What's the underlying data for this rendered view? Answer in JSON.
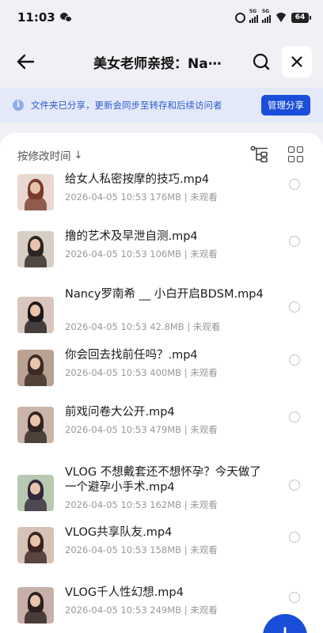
{
  "status_bar": {
    "time": "11:03",
    "signal_1": "5G",
    "signal_2": "5G",
    "battery": "64"
  },
  "header": {
    "title": "美女老师亲授：Na⋯",
    "back_icon": "back-arrow-icon",
    "search_icon": "search-icon",
    "close_icon": "close-icon"
  },
  "share_banner": {
    "info_icon": "i",
    "text": "文件夹已分享，更新会同步至转存和后续访问者",
    "button": "管理分享"
  },
  "toolbar": {
    "sort_label": "按修改时间",
    "sort_arrow": "↓"
  },
  "files": [
    {
      "name": "给女人私密按摩的技巧.mp4",
      "meta": "2026-04-05 10:53  176MB | 未观看",
      "thumb_bg": "#e8d8cf",
      "figure": "#7a3b2e"
    },
    {
      "name": "撸的艺术及早泄自测.mp4",
      "meta": "2026-04-05 10:53  106MB | 未观看",
      "thumb_bg": "#d7cfc4",
      "figure": "#2a2522"
    },
    {
      "name": "Nancy罗南希 __ 小白开启BDSM.mp4",
      "meta": "2026-04-05 10:53  42.8MB | 未观看",
      "thumb_bg": "#d9c7bd",
      "figure": "#1e1a1a"
    },
    {
      "name": "你会回去找前任吗？.mp4",
      "meta": "2026-04-05 10:53  400MB | 未观看",
      "thumb_bg": "#b9a193",
      "figure": "#3a2a24"
    },
    {
      "name": "前戏问卷大公开.mp4",
      "meta": "2026-04-05 10:53  479MB | 未观看",
      "thumb_bg": "#c9b5aa",
      "figure": "#2e2420"
    },
    {
      "name": "VLOG 不想戴套还不想怀孕？今天做了一个避孕小手术.mp4",
      "meta": "2026-04-05 10:53  162MB | 未观看",
      "thumb_bg": "#b8c9b2",
      "figure": "#33283a"
    },
    {
      "name": "VLOG共享队友.mp4",
      "meta": "2026-04-05 10:53  158MB | 未观看",
      "thumb_bg": "#d6c2b7",
      "figure": "#3a2420"
    },
    {
      "name": "VLOG千人性幻想.mp4",
      "meta": "2026-04-05 10:53  249MB | 未观看",
      "thumb_bg": "#c7b0a7",
      "figure": "#2b211e"
    }
  ],
  "fab_label": "+",
  "colors": {
    "accent": "#1a4ed8",
    "banner_bg": "#e3e9f8",
    "banner_text": "#2f5bd0",
    "page_bg": "#f0f1f4"
  }
}
